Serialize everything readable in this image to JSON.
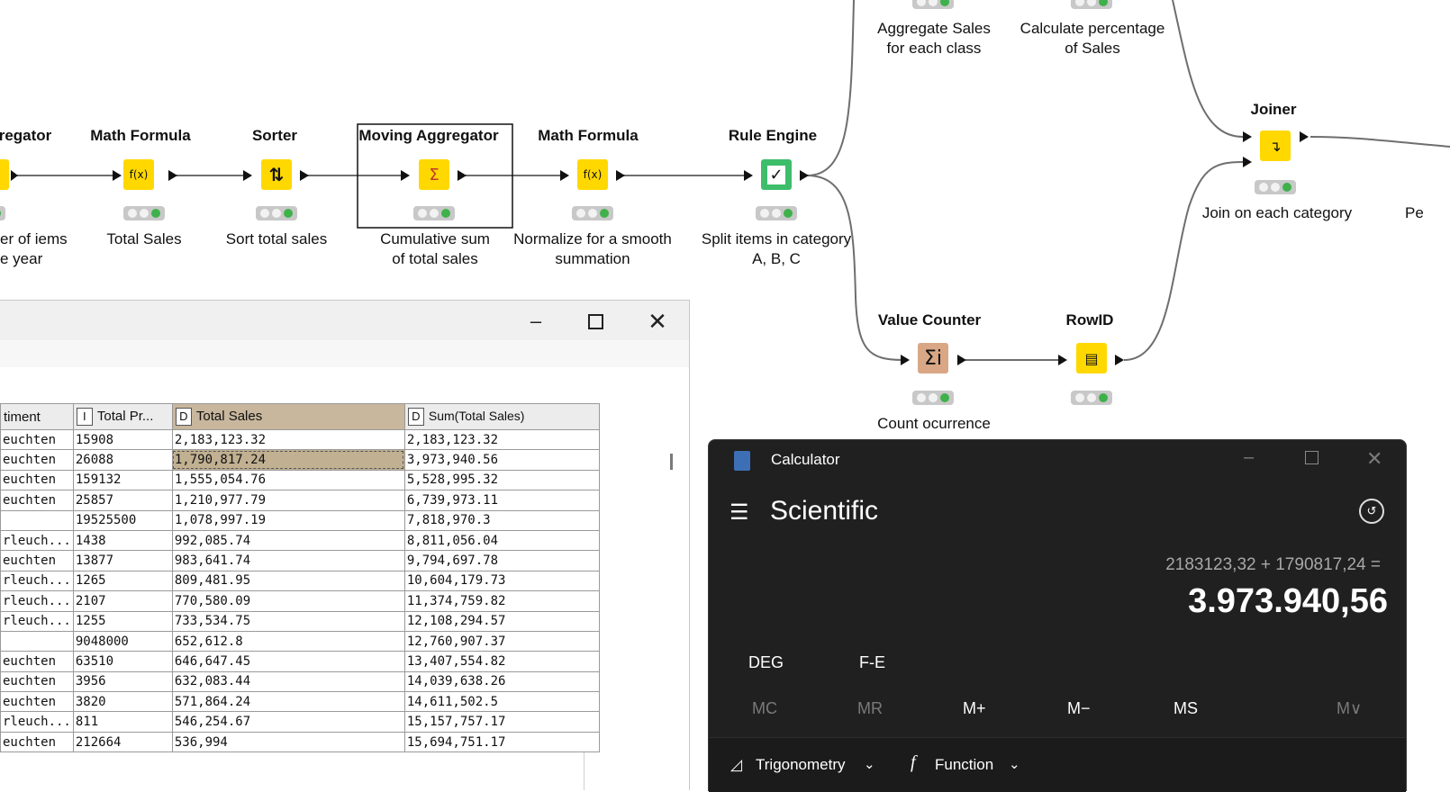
{
  "workflow": {
    "nodes": [
      {
        "id": "aggregator",
        "title": "regator",
        "desc": "er of iems\ne year",
        "icon": "aggregator-icon"
      },
      {
        "id": "math1",
        "title": "Math Formula",
        "desc": "Total Sales",
        "icon": "math-formula-icon"
      },
      {
        "id": "sorter",
        "title": "Sorter",
        "desc": "Sort total sales",
        "icon": "sorter-icon"
      },
      {
        "id": "moving",
        "title": "Moving Aggregator",
        "desc": "Cumulative sum\nof total sales",
        "icon": "moving-aggregator-icon"
      },
      {
        "id": "math2",
        "title": "Math Formula",
        "desc": "Normalize for a smooth\nsummation",
        "icon": "math-formula-icon"
      },
      {
        "id": "rule",
        "title": "Rule Engine",
        "desc": "Split items in category\nA, B, C",
        "icon": "rule-engine-icon"
      },
      {
        "id": "aggclass",
        "title": "",
        "desc": "Aggregate Sales\nfor each class",
        "icon": ""
      },
      {
        "id": "calcpct",
        "title": "",
        "desc": "Calculate percentage\nof Sales",
        "icon": ""
      },
      {
        "id": "joiner",
        "title": "Joiner",
        "desc": "Join on each category",
        "icon": "joiner-icon"
      },
      {
        "id": "valcount",
        "title": "Value Counter",
        "desc": "Count ocurrence",
        "icon": "value-counter-icon"
      },
      {
        "id": "rowid",
        "title": "RowID",
        "desc": "",
        "icon": "rowid-icon"
      },
      {
        "id": "partial",
        "title": "",
        "desc": "Pe",
        "icon": ""
      }
    ]
  },
  "table": {
    "headers": [
      {
        "type": "",
        "label": "timent"
      },
      {
        "type": "I",
        "label": "Total Pr..."
      },
      {
        "type": "D",
        "label": "Total Sales"
      },
      {
        "type": "D",
        "label": "Sum(Total Sales)"
      }
    ],
    "rows": [
      [
        "euchten",
        "15908",
        "2,183,123.32",
        "2,183,123.32"
      ],
      [
        "euchten",
        "26088",
        "1,790,817.24",
        "3,973,940.56"
      ],
      [
        "euchten",
        "159132",
        "1,555,054.76",
        "5,528,995.32"
      ],
      [
        "euchten",
        "25857",
        "1,210,977.79",
        "6,739,973.11"
      ],
      [
        "",
        "19525500",
        "1,078,997.19",
        "7,818,970.3"
      ],
      [
        "rleuch...",
        "1438",
        "992,085.74",
        "8,811,056.04"
      ],
      [
        "euchten",
        "13877",
        "983,641.74",
        "9,794,697.78"
      ],
      [
        "rleuch...",
        "1265",
        "809,481.95",
        "10,604,179.73"
      ],
      [
        "rleuch...",
        "2107",
        "770,580.09",
        "11,374,759.82"
      ],
      [
        "rleuch...",
        "1255",
        "733,534.75",
        "12,108,294.57"
      ],
      [
        "",
        "9048000",
        "652,612.8",
        "12,760,907.37"
      ],
      [
        "euchten",
        "63510",
        "646,647.45",
        "13,407,554.82"
      ],
      [
        "euchten",
        "3956",
        "632,083.44",
        "14,039,638.26"
      ],
      [
        "euchten",
        "3820",
        "571,864.24",
        "14,611,502.5"
      ],
      [
        "rleuch...",
        "811",
        "546,254.67",
        "15,157,757.17"
      ],
      [
        "euchten",
        "212664",
        "536,994",
        "15,694,751.17"
      ]
    ]
  },
  "calculator": {
    "title": "Calculator",
    "mode": "Scientific",
    "expression": "2183123,32 + 1790817,24 =",
    "result": "3.973.940,56",
    "deg": "DEG",
    "fe": "F-E",
    "memory": [
      "MC",
      "MR",
      "M+",
      "M−",
      "MS",
      "M∨"
    ],
    "trig": "Trigonometry",
    "func": "Function"
  }
}
